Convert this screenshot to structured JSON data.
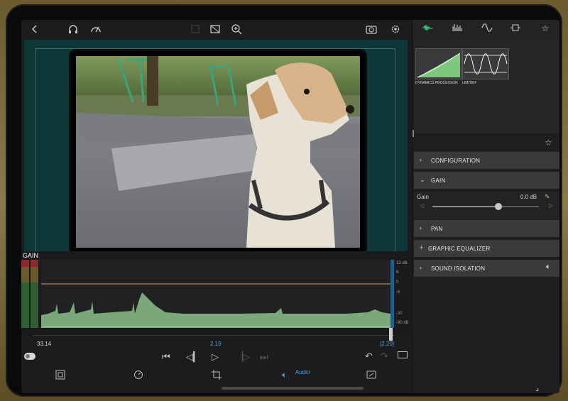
{
  "app": {
    "left_toolbar": {
      "back_icon": "chevron-left-icon",
      "headphones_icon": "headphones-icon",
      "gauge_icon": "gauge-icon",
      "crop_icon": "aspect-ratio-icon",
      "zoom_icon": "zoom-in-icon",
      "camera_icon": "camera-icon",
      "settings_icon": "gear-icon"
    },
    "waveform": {
      "title": "GAIN",
      "db_labels": [
        "12 dB",
        "6",
        "0",
        "-6",
        "-30",
        "-90 dB"
      ],
      "time_left": "33.14",
      "time_mid": "2.19",
      "time_right": "[2.20]"
    },
    "bottom_bar": {
      "audio_label": "Audio"
    }
  },
  "right_panel": {
    "tabs": [
      "waveform-icon",
      "spectrum-icon",
      "sine-icon",
      "filter-icon",
      "star-icon"
    ],
    "plugins": [
      {
        "label": "DYNAMICS PROCESSOR"
      },
      {
        "label": "LIMITER"
      }
    ],
    "sections": {
      "configuration": "CONFIGURATION",
      "gain": "GAIN",
      "pan": "PAN",
      "graphic_eq": "GRAPHIC EQUALIZER",
      "sound_isolation": "SOUND ISOLATION"
    },
    "gain_control": {
      "label": "Gain",
      "value": "0.0 dB",
      "slider_fraction": 0.62
    }
  },
  "colors": {
    "accent_blue": "#4aa0dc",
    "accent_green": "#37c06b",
    "preview_bg": "#0d3838",
    "wave_fill": "#7aa87a"
  }
}
